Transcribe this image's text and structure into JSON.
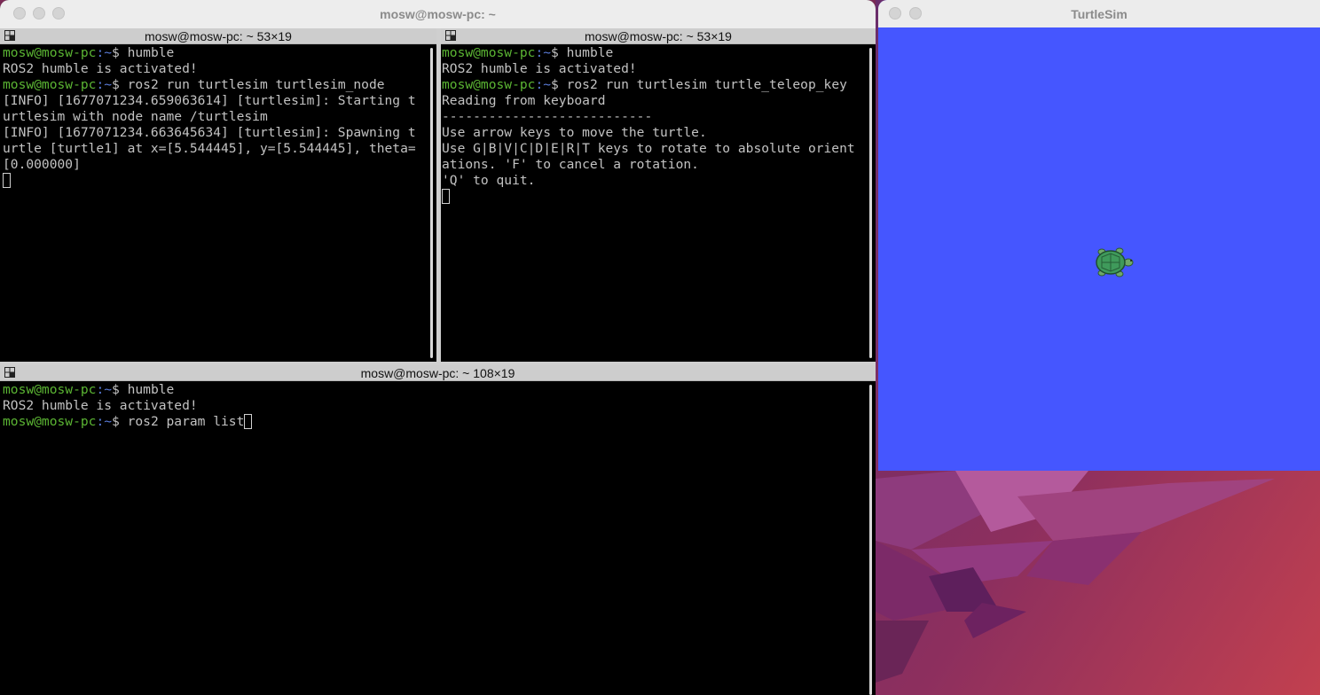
{
  "terminal_window": {
    "title": "mosw@mosw-pc: ~",
    "panes": {
      "top_left": {
        "header": "mosw@mosw-pc: ~ 53×19",
        "lines": [
          {
            "user": "mosw@mosw-pc",
            "path": ":~",
            "cmd": "$ humble"
          },
          {
            "text": "ROS2 humble is activated!"
          },
          {
            "user": "mosw@mosw-pc",
            "path": ":~",
            "cmd": "$ ros2 run turtlesim turtlesim_node"
          },
          {
            "text": "[INFO] [1677071234.659063614] [turtlesim]: Starting t"
          },
          {
            "text": "urtlesim with node name /turtlesim"
          },
          {
            "text": "[INFO] [1677071234.663645634] [turtlesim]: Spawning t"
          },
          {
            "text": "urtle [turtle1] at x=[5.544445], y=[5.544445], theta="
          },
          {
            "text": "[0.000000]"
          }
        ]
      },
      "top_right": {
        "header": "mosw@mosw-pc: ~ 53×19",
        "lines": [
          {
            "user": "mosw@mosw-pc",
            "path": ":~",
            "cmd": "$ humble"
          },
          {
            "text": "ROS2 humble is activated!"
          },
          {
            "user": "mosw@mosw-pc",
            "path": ":~",
            "cmd": "$ ros2 run turtlesim turtle_teleop_key"
          },
          {
            "text": "Reading from keyboard"
          },
          {
            "text": "---------------------------"
          },
          {
            "text": "Use arrow keys to move the turtle."
          },
          {
            "text": "Use G|B|V|C|D|E|R|T keys to rotate to absolute orient"
          },
          {
            "text": "ations. 'F' to cancel a rotation."
          },
          {
            "text": "'Q' to quit."
          }
        ]
      },
      "bottom": {
        "header": "mosw@mosw-pc: ~ 108×19",
        "lines": [
          {
            "user": "mosw@mosw-pc",
            "path": ":~",
            "cmd": "$ humble"
          },
          {
            "text": "ROS2 humble is activated!"
          },
          {
            "user": "mosw@mosw-pc",
            "path": ":~",
            "cmd": "$ ros2 param list"
          }
        ]
      }
    }
  },
  "turtlesim_window": {
    "title": "TurtleSim",
    "background_color": "#4556ff"
  },
  "colors": {
    "prompt_user": "#5bb533",
    "prompt_path": "#5a7bd8",
    "output_text": "#c2c2c2"
  },
  "icons": {
    "window_buttons": "traffic-light-buttons-inactive",
    "pane_icon": "split-pane-icon",
    "turtle": "turtle-icon"
  }
}
